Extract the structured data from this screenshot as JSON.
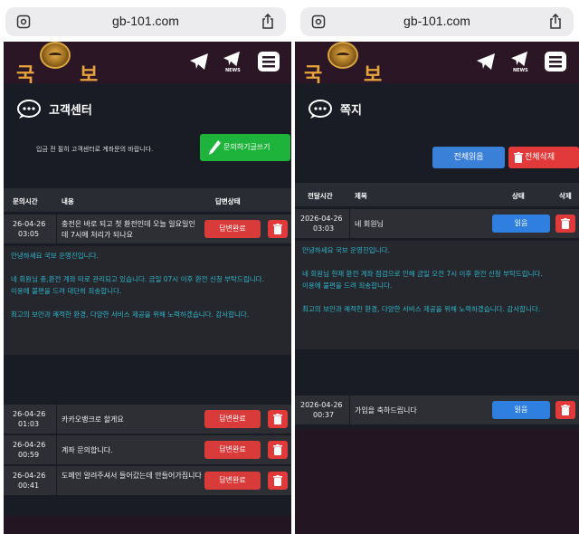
{
  "left": {
    "url": "gb-101.com",
    "logo": {
      "left_char": "국",
      "right_char": "보"
    },
    "nav": {
      "news_label": "NEWS"
    },
    "section_title": "고객센터",
    "notice": "입금 전 필히 고객센터로 계좌문의 바랍니다.",
    "write_button": "문의하기글쓰기",
    "table": {
      "headers": {
        "date": "문의시간",
        "content": "내용",
        "status": "답변상태"
      },
      "rows": [
        {
          "date_line1": "26-04-26",
          "date_line2": "03:05",
          "subject": "충전은 바로 되고 첫 환전인데 오늘 일요일인데 7시에 처리가 되나요",
          "status": "답변완료"
        },
        {
          "date_line1": "26-04-26",
          "date_line2": "01:03",
          "subject": "카카오뱅크로 할게요",
          "status": "답변완료"
        },
        {
          "date_line1": "26-04-26",
          "date_line2": "00:59",
          "subject": "계좌 문의합니다.",
          "status": "답변완료"
        },
        {
          "date_line1": "26-04-26",
          "date_line2": "00:41",
          "subject": "도메인 알려주셔서 들어갔는데 안들어가집니다",
          "status": "답변완료"
        }
      ]
    },
    "answer": {
      "line1": "안녕하세요 국보 운영진입니다.",
      "line2": "네 회원님 충,환전 계좌 따로 관리되고 있습니다. 금일 07시 이후 환전 신청 부탁드립니다.",
      "line3": "이용에 불편을 드려 대단히 죄송합니다.",
      "line4": "최고의 보안과 쾌적한 환경, 다양한 서비스 제공을 위해 노력하겠습니다. 감사합니다."
    }
  },
  "right": {
    "url": "gb-101.com",
    "logo": {
      "left_char": "국",
      "right_char": "보"
    },
    "nav": {
      "news_label": "NEWS"
    },
    "section_title": "쪽지",
    "read_all_button": "전체읽음",
    "delete_all_button": "전체삭제",
    "table": {
      "headers": {
        "date": "전달시간",
        "subject": "제목",
        "status": "상태",
        "delete": "삭제"
      },
      "rows": [
        {
          "date_line1": "2026-04-26",
          "date_line2": "03:03",
          "subject": "네 회원님",
          "status": "읽음"
        },
        {
          "date_line1": "2026-04-26",
          "date_line2": "00:37",
          "subject": "가입을 축하드립니다",
          "status": "읽음"
        }
      ]
    },
    "message": {
      "line1": "안녕하세요 국보 운영진입니다.",
      "line2": "네 회원님 현재 환전 계좌 점검으로 인해 금일 오전 7시 이후 환전 신청 부탁드립니다.",
      "line3": "이용에 불편을 드려 죄송합니다.",
      "line4": "최고의 보안과 쾌적한 환경, 다양한 서비스 제공을 위해 노력하겠습니다. 감사합니다."
    }
  },
  "colors": {
    "page_bg": "#241522",
    "content_bg": "#1a1c25",
    "row_bg": "#2d2f35",
    "answer_text": "#2fb3c9",
    "status_red": "#d93a3a",
    "status_blue": "#2f7fe0",
    "write_green": "#1eb33a",
    "logo_gold": "#e8a33c"
  },
  "icons": [
    "lock-icon",
    "share-icon",
    "telegram-icon",
    "telegram-news-icon",
    "menu-icon",
    "chat-bubble-icon",
    "pencil-icon",
    "trash-icon"
  ]
}
